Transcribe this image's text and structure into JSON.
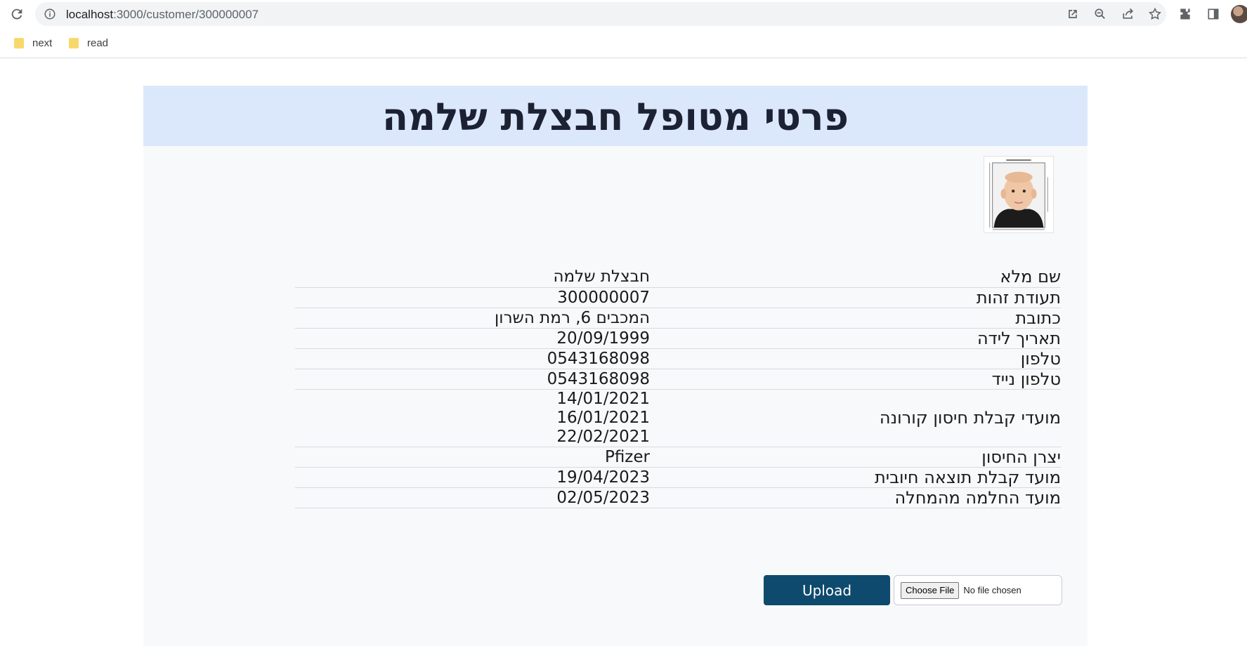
{
  "browser": {
    "url_host": "localhost",
    "url_rest": ":3000/customer/300000007",
    "bookmarks": [
      {
        "label": "next"
      },
      {
        "label": "read"
      }
    ]
  },
  "page": {
    "title": "פרטי מטופל חבצלת שלמה",
    "fields": [
      {
        "label": "שם מלא",
        "values": [
          "חבצלת שלמה"
        ]
      },
      {
        "label": "תעודת זהות",
        "values": [
          "300000007"
        ]
      },
      {
        "label": "כתובת",
        "values": [
          "המכבים 6, רמת השרון"
        ]
      },
      {
        "label": "תאריך לידה",
        "values": [
          "20/09/1999"
        ]
      },
      {
        "label": "טלפון",
        "values": [
          "0543168098"
        ]
      },
      {
        "label": "טלפון נייד",
        "values": [
          "0543168098"
        ]
      },
      {
        "label": "מועדי קבלת חיסון קורונה",
        "values": [
          "14/01/2021",
          "16/01/2021",
          "22/02/2021"
        ]
      },
      {
        "label": "יצרן החיסון",
        "values": [
          "Pfizer"
        ]
      },
      {
        "label": "מועד קבלת תוצאה חיובית",
        "values": [
          "19/04/2023"
        ]
      },
      {
        "label": "מועד החלמה מהמחלה",
        "values": [
          "02/05/2023"
        ]
      }
    ],
    "upload_label": "Upload",
    "choose_file_label": "Choose File",
    "no_file_label": "No file chosen"
  },
  "colors": {
    "title_band": "#dbe8fb",
    "upload_button": "#0e4a6e",
    "card_background": "#f8f9fb"
  }
}
